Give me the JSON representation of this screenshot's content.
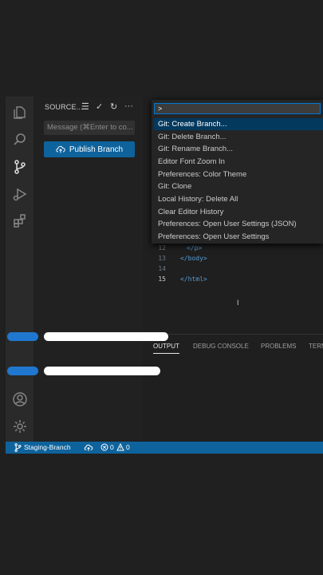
{
  "sidebar": {
    "title": "SOURCE...",
    "message_placeholder": "Message (⌘Enter to co...",
    "publish_label": "Publish Branch"
  },
  "command_palette": {
    "input_value": ">",
    "items": [
      "Git: Create Branch...",
      "Git: Delete Branch...",
      "Git: Rename Branch...",
      "Editor Font Zoom In",
      "Preferences: Color Theme",
      "Git: Clone",
      "Local History: Delete All",
      "Clear Editor History",
      "Preferences: Open User Settings (JSON)",
      "Preferences: Open User Settings"
    ]
  },
  "editor": {
    "lines": [
      {
        "num": "12",
        "text": "</p>"
      },
      {
        "num": "13",
        "text": "</body>"
      },
      {
        "num": "14",
        "text": ""
      },
      {
        "num": "15",
        "text": "</html>"
      }
    ]
  },
  "panel": {
    "tabs": [
      "OUTPUT",
      "DEBUG CONSOLE",
      "PROBLEMS",
      "TERM"
    ]
  },
  "status": {
    "branch": "Staging-Branch",
    "errors": "0",
    "warnings": "0"
  },
  "colors": {
    "accent": "#0e639c",
    "selection": "#04395e"
  }
}
